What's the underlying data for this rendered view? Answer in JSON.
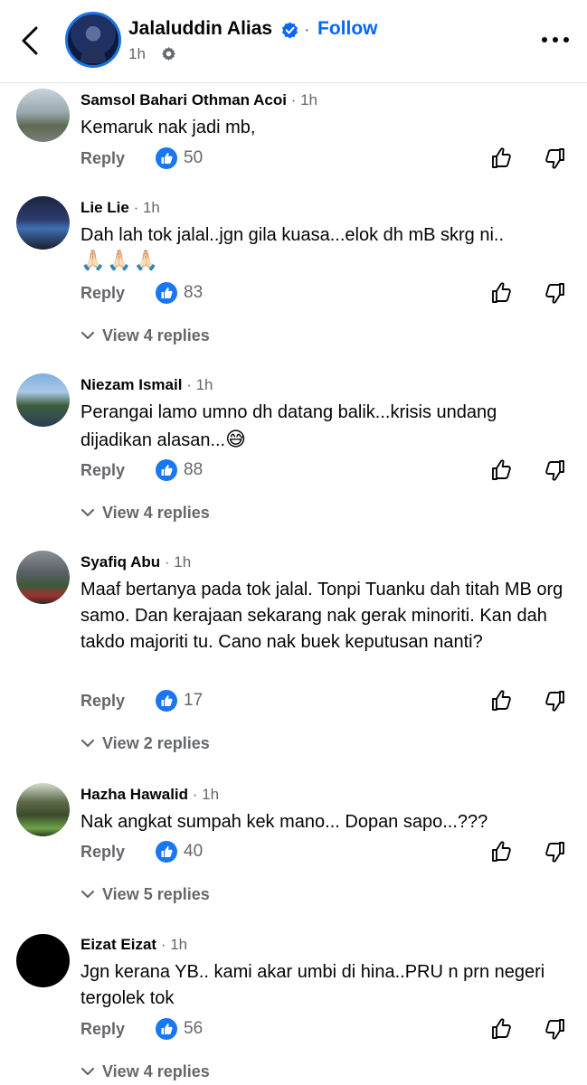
{
  "header": {
    "page_name": "Jalaluddin Alias",
    "follow_label": "Follow",
    "post_time": "1h"
  },
  "comments": [
    {
      "name": "Samsol Bahari Othman Acoi",
      "time": "· 1h",
      "text": "Kemaruk nak jadi mb,",
      "reply_label": "Reply",
      "likes": "50"
    },
    {
      "name": "Lie Lie",
      "time": "· 1h",
      "text": "Dah lah tok jalal..jgn gila kuasa...elok dh mB skrg ni..",
      "emoji_line": "🙏🏻🙏🏻🙏🏻",
      "reply_label": "Reply",
      "likes": "83",
      "view_replies": "View 4 replies"
    },
    {
      "name": "Niezam Ismail",
      "time": "· 1h",
      "text_line1": "Perangai lamo umno dh datang balik...krisis undang",
      "text_line2": "dijadikan alasan...",
      "text_emoji": "😅",
      "reply_label": "Reply",
      "likes": "88",
      "view_replies": "View 4 replies"
    },
    {
      "name": "Syafiq Abu",
      "time": "· 1h",
      "text": "Maaf bertanya pada tok jalal. Tonpi Tuanku dah titah MB org samo. Dan kerajaan sekarang nak gerak minoriti. Kan dah takdo majoriti tu. Cano nak buek keputusan nanti?",
      "reply_label": "Reply",
      "likes": "17",
      "view_replies": "View 2 replies"
    },
    {
      "name": "Hazha Hawalid",
      "time": "· 1h",
      "text": "Nak angkat sumpah kek mano... Dopan sapo...???",
      "reply_label": "Reply",
      "likes": "40",
      "view_replies": "View 5 replies"
    },
    {
      "name": "Eizat Eizat",
      "time": "· 1h",
      "text": "Jgn kerana YB.. kami akar umbi di hina..PRU n prn negeri tergolek tok",
      "reply_label": "Reply",
      "likes": "56",
      "view_replies": "View 4 replies"
    }
  ],
  "icons": {
    "back": "chevron-left-icon",
    "verified": "verified-badge-icon",
    "privacy": "gear-icon",
    "more": "more-horizontal-icon",
    "like": "like-reaction-icon",
    "upvote": "thumbs-up-icon",
    "downvote": "thumbs-down-icon",
    "expand": "chevron-down-icon"
  },
  "colors": {
    "accent": "#0866ff",
    "secondary_text": "#65676b",
    "primary_text": "#050505"
  }
}
